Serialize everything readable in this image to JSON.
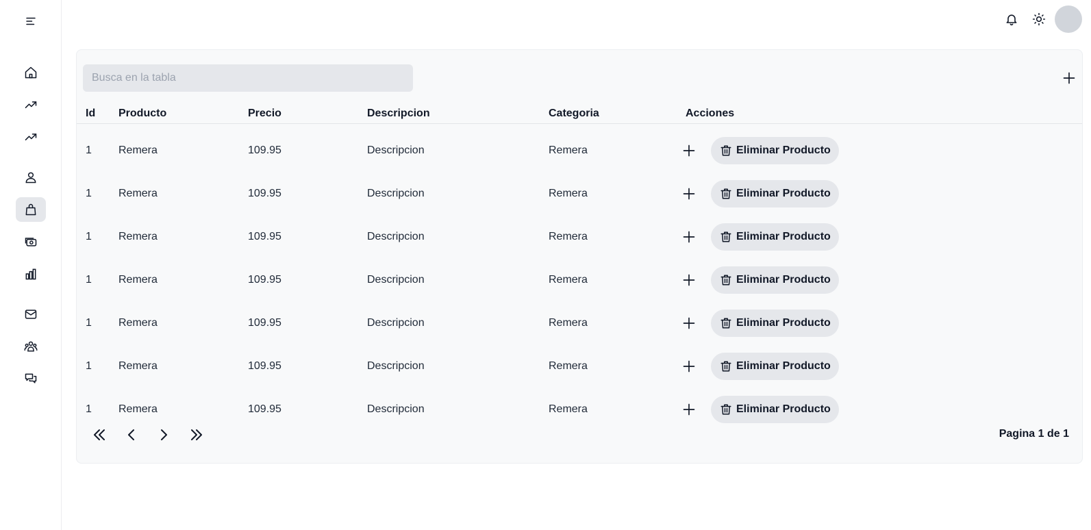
{
  "sidebar": {
    "items": [
      {
        "icon": "menu-icon"
      },
      {
        "icon": "home-icon"
      },
      {
        "icon": "trending-up-icon"
      },
      {
        "icon": "trending-up-icon"
      },
      {
        "icon": "user-icon"
      },
      {
        "icon": "shopping-bag-icon",
        "active": true
      },
      {
        "icon": "cash-icon"
      },
      {
        "icon": "bar-chart-icon"
      },
      {
        "icon": "mail-icon"
      },
      {
        "icon": "users-group-icon"
      },
      {
        "icon": "chat-icon"
      }
    ]
  },
  "topbar": {
    "icons": [
      "bell-icon",
      "sun-icon"
    ],
    "avatar_color": "#d1d5db"
  },
  "table": {
    "search_placeholder": "Busca en la tabla",
    "add_icon": "plus-icon",
    "columns": [
      "Id",
      "Producto",
      "Precio",
      "Descripcion",
      "Categoria",
      "Acciones"
    ],
    "rows": [
      {
        "id": "1",
        "producto": "Remera",
        "precio": "109.95",
        "descripcion": "Descripcion",
        "categoria": "Remera",
        "delete_label": "Eliminar Producto"
      },
      {
        "id": "1",
        "producto": "Remera",
        "precio": "109.95",
        "descripcion": "Descripcion",
        "categoria": "Remera",
        "delete_label": "Eliminar Producto"
      },
      {
        "id": "1",
        "producto": "Remera",
        "precio": "109.95",
        "descripcion": "Descripcion",
        "categoria": "Remera",
        "delete_label": "Eliminar Producto"
      },
      {
        "id": "1",
        "producto": "Remera",
        "precio": "109.95",
        "descripcion": "Descripcion",
        "categoria": "Remera",
        "delete_label": "Eliminar Producto"
      },
      {
        "id": "1",
        "producto": "Remera",
        "precio": "109.95",
        "descripcion": "Descripcion",
        "categoria": "Remera",
        "delete_label": "Eliminar Producto"
      },
      {
        "id": "1",
        "producto": "Remera",
        "precio": "109.95",
        "descripcion": "Descripcion",
        "categoria": "Remera",
        "delete_label": "Eliminar Producto"
      },
      {
        "id": "1",
        "producto": "Remera",
        "precio": "109.95",
        "descripcion": "Descripcion",
        "categoria": "Remera",
        "delete_label": "Eliminar Producto"
      }
    ]
  },
  "pagination": {
    "buttons": [
      "first-page-icon",
      "previous-page-icon",
      "next-page-icon",
      "last-page-icon"
    ],
    "page_info": "Pagina 1 de 1"
  },
  "colors": {
    "card_background": "#f8f9fa",
    "button_background": "#e5e7eb",
    "text": "#111827"
  }
}
